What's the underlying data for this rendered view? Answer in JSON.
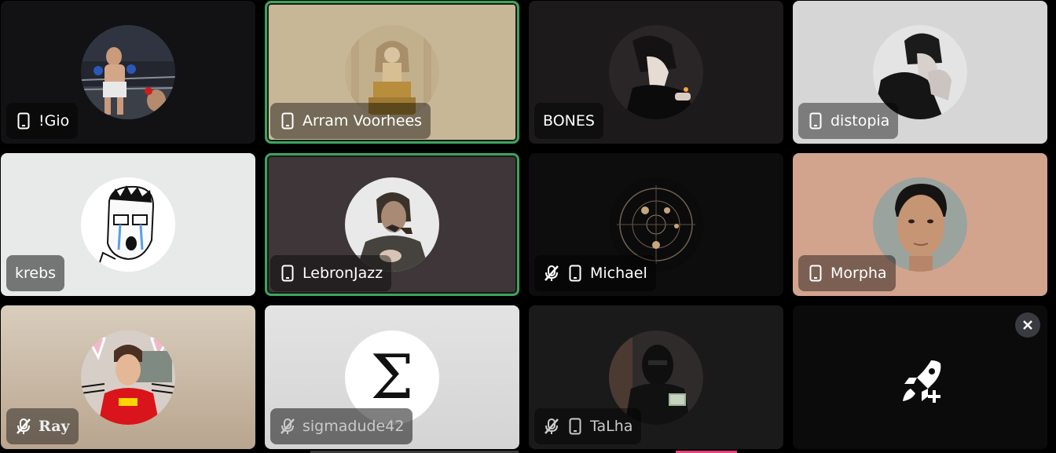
{
  "participants": [
    {
      "name": "!Gio",
      "mobile": true,
      "muted": false,
      "speaking": false,
      "bg": "#121214",
      "avatar": "boxer-photo"
    },
    {
      "name": "Arram Voorhees",
      "mobile": true,
      "muted": false,
      "speaking": true,
      "bg": "#c8b796",
      "avatar": "zeus-statue-photo"
    },
    {
      "name": "BONES",
      "mobile": false,
      "muted": false,
      "speaking": false,
      "bg": "#1c1a1b",
      "avatar": "anime-smoking-avatar"
    },
    {
      "name": "distopia",
      "mobile": true,
      "muted": false,
      "speaking": false,
      "bg": "#d6d6d6",
      "avatar": "bw-person-photo"
    },
    {
      "name": "krebs",
      "mobile": false,
      "muted": false,
      "speaking": false,
      "bg": "#e8eaea",
      "avatar": "crying-wojak-drawing"
    },
    {
      "name": "LebronJazz",
      "mobile": true,
      "muted": false,
      "speaking": true,
      "bg": "#3e3638",
      "avatar": "man-with-pipe-photo"
    },
    {
      "name": "Michael",
      "mobile": true,
      "muted": true,
      "speaking": false,
      "bg": "#0d0d0d",
      "avatar": "zodiac-chart-avatar"
    },
    {
      "name": "Morpha",
      "mobile": true,
      "muted": false,
      "speaking": false,
      "bg": "#d2a48d",
      "avatar": "face-photo"
    },
    {
      "name": "Ray",
      "mobile": false,
      "muted": true,
      "speaking": false,
      "bg": "#cbbba6",
      "avatar": "racer-cat-ears-photo"
    },
    {
      "name": "sigmadude42",
      "mobile": false,
      "muted": true,
      "speaking": false,
      "bg": "#dedede",
      "avatar": "sigma-symbol"
    },
    {
      "name": "TaLha",
      "mobile": true,
      "muted": true,
      "speaking": false,
      "bg": "#1a1a1a",
      "avatar": "masked-man-photo"
    }
  ],
  "sigma_symbol": "Σ",
  "activity_tile": {
    "icon": "rocket-add-icon",
    "close_icon": "close-icon"
  },
  "colors": {
    "speaking_border": "#3ba55c",
    "page_bg": "#000000"
  }
}
